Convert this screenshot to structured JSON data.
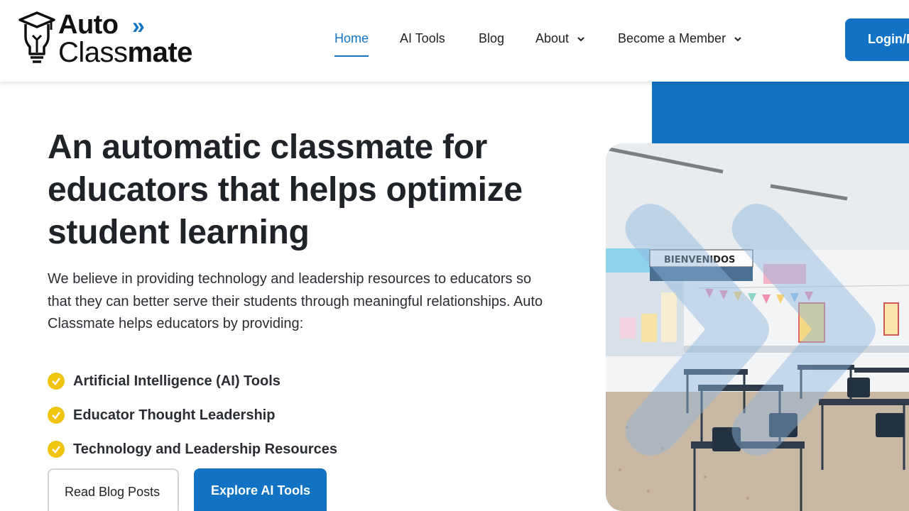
{
  "brand": {
    "line1": "Auto",
    "chevron": "»",
    "line2_regular": "Class",
    "line2_bold": "mate",
    "icon": "lightbulb-graduation-cap-icon",
    "accent": "#1273c4"
  },
  "nav": {
    "items": [
      {
        "label": "Home",
        "active": true
      },
      {
        "label": "AI Tools"
      },
      {
        "label": "Blog"
      },
      {
        "label": "About",
        "dropdown": true
      },
      {
        "label": "Become a Member",
        "dropdown": true
      }
    ],
    "login_label": "Login/R"
  },
  "hero": {
    "title": "An automatic classmate for educators that helps optimize student learning",
    "description": "We believe in providing technology and leadership resources to educators so that they can better serve their students through meaningful relationships. Auto Classmate helps educators by providing:",
    "features": [
      "Artificial Intelligence (AI) Tools",
      "Educator Thought Leadership",
      "Technology and Leadership Resources"
    ],
    "buttons": {
      "secondary": "Read Blog Posts",
      "primary": "Explore AI Tools"
    }
  },
  "photo": {
    "banner_text": "BIENVENIDOS"
  },
  "colors": {
    "primary": "#1273c4",
    "check": "#f1c40f",
    "text": "#1f2328"
  }
}
